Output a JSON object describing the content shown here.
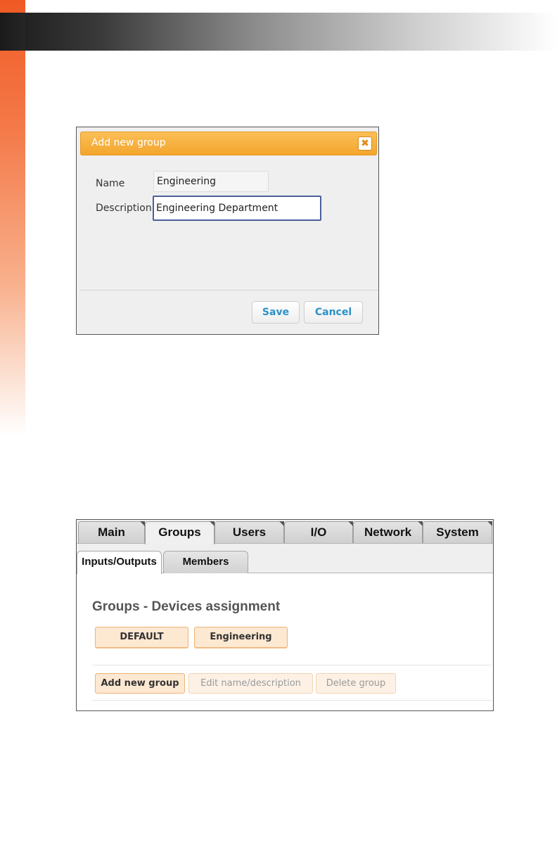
{
  "dialog": {
    "title": "Add new group",
    "close_icon": "close-icon",
    "close_glyph": "✖",
    "fields": {
      "name_label": "Name",
      "name_value": "Engineering",
      "description_label": "Description",
      "description_value": "Engineering Department"
    },
    "buttons": {
      "save_label": "Save",
      "cancel_label": "Cancel"
    },
    "colors": {
      "header": "#f3a52c",
      "button_text": "#2a91c8",
      "focus_border": "#4a5f9e"
    }
  },
  "device_ui": {
    "tabs": [
      "Main",
      "Groups",
      "Users",
      "I/O",
      "Network",
      "System"
    ],
    "active_tab": "Groups",
    "subtabs": [
      "Inputs/Outputs",
      "Members"
    ],
    "active_subtab": "Inputs/Outputs",
    "section_title": "Groups - Devices assignment",
    "groups": [
      "DEFAULT",
      "Engineering"
    ],
    "actions": {
      "add_label": "Add new group",
      "edit_label": "Edit name/description",
      "delete_label": "Delete group"
    },
    "colors": {
      "group_button": "#fde8d2",
      "group_border": "#f0b277"
    }
  }
}
